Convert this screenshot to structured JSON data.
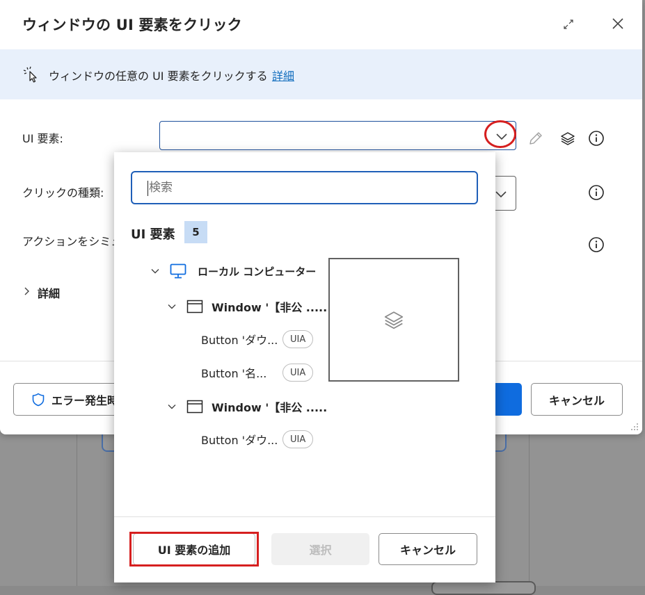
{
  "dialog": {
    "title": "ウィンドウの UI 要素をクリック",
    "banner": {
      "text": "ウィンドウの任意の UI 要素をクリックする",
      "link": "詳細"
    },
    "fields": {
      "ui_element_label": "UI 要素:",
      "click_type_label": "クリックの種類:",
      "simulate_label": "アクションをシミュレー",
      "details_label": "詳細"
    },
    "footer": {
      "on_error_label": "エラー発生時",
      "cancel_label": "キャンセル"
    }
  },
  "popup": {
    "search_placeholder": "検索",
    "section_title": "UI 要素",
    "count": "5",
    "tree": {
      "root": "ローカル コンピューター",
      "windows": [
        {
          "label": "Window '【非公 .....",
          "buttons": [
            {
              "label": "Button 'ダウ...",
              "badge": "UIA"
            },
            {
              "label": "Button '名...",
              "badge": "UIA"
            }
          ]
        },
        {
          "label": "Window '【非公 .....",
          "buttons": [
            {
              "label": "Button 'ダウ...",
              "badge": "UIA"
            }
          ]
        }
      ]
    },
    "footer": {
      "add_label": "UI 要素の追加",
      "select_label": "選択",
      "cancel_label": "キャンセル"
    }
  },
  "colors": {
    "accent": "#0f6cdf",
    "highlight": "#d61f1f",
    "banner_bg": "#e8f0fb",
    "count_bg": "#c7dcf5"
  }
}
